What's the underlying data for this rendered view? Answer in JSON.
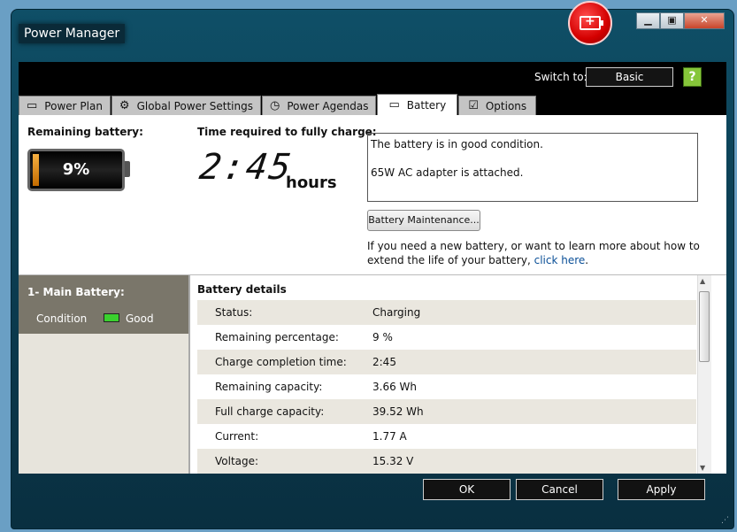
{
  "window": {
    "title": "Power Manager"
  },
  "header": {
    "switch_to_label": "Switch to:",
    "basic_button": "Basic",
    "help_icon": "question-download-icon"
  },
  "tabs": [
    {
      "label": "Power Plan",
      "icon": "power-plan-icon"
    },
    {
      "label": "Global Power Settings",
      "icon": "gear-icon"
    },
    {
      "label": "Power Agendas",
      "icon": "clock-icon"
    },
    {
      "label": "Battery",
      "icon": "battery-icon",
      "active": true
    },
    {
      "label": "Options",
      "icon": "checkbox-icon"
    }
  ],
  "battery_summary": {
    "remaining_label": "Remaining battery:",
    "remaining_percent": "9%",
    "remaining_level": 0.09,
    "charge_time_label": "Time required to fully charge:",
    "charge_time": "2:45",
    "charge_time_unit": "hours",
    "status_message_1": "The battery is in good condition.",
    "status_message_2": "65W AC adapter is attached.",
    "maintenance_button": "Battery Maintenance...",
    "help_text": "If you need a new battery, or want to learn more about how to extend the life of your battery,",
    "help_link": "click here",
    "help_text_end": "."
  },
  "batteries": [
    {
      "title": "1- Main Battery:",
      "condition_label": "Condition",
      "condition_value": "Good"
    }
  ],
  "details": {
    "title": "Battery details",
    "rows": [
      {
        "label": "Status:",
        "value": "Charging"
      },
      {
        "label": "Remaining percentage:",
        "value": "9 %"
      },
      {
        "label": "Charge completion time:",
        "value": "2:45"
      },
      {
        "label": "Remaining capacity:",
        "value": "3.66 Wh"
      },
      {
        "label": "Full charge capacity:",
        "value": "39.52 Wh"
      },
      {
        "label": "Current:",
        "value": "1.77 A"
      },
      {
        "label": "Voltage:",
        "value": "15.32 V"
      }
    ]
  },
  "footer": {
    "ok": "OK",
    "cancel": "Cancel",
    "apply": "Apply"
  }
}
